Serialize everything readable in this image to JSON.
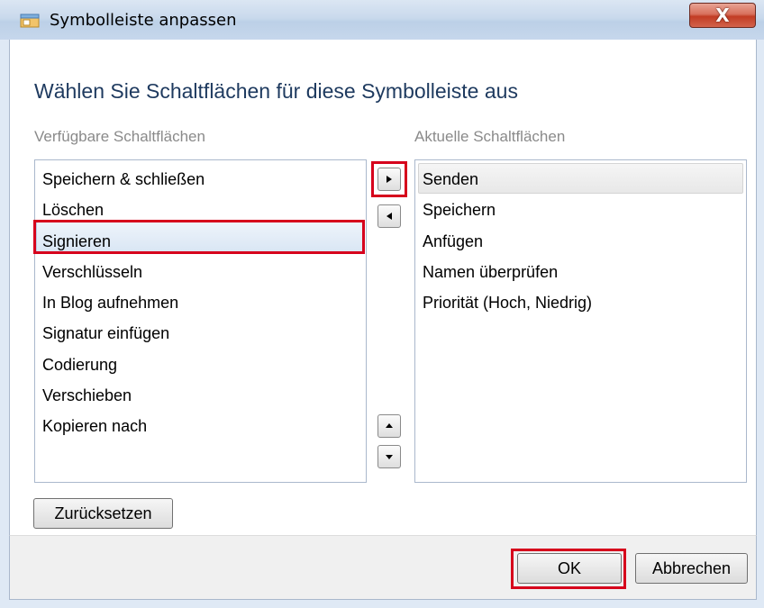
{
  "window": {
    "title": "Symbolleiste anpassen",
    "close_label": "X"
  },
  "dialog": {
    "heading": "Wählen Sie Schaltflächen für diese Symbolleiste aus",
    "available_label": "Verfügbare Schaltflächen",
    "current_label": "Aktuelle Schaltflächen"
  },
  "available": {
    "items": [
      "Speichern & schließen",
      "Löschen",
      "Signieren",
      "Verschlüsseln",
      "In Blog aufnehmen",
      "Signatur einfügen",
      "Codierung",
      "Verschieben",
      "Kopieren nach"
    ],
    "selected": "Signieren"
  },
  "current": {
    "items": [
      "Senden",
      "Speichern",
      "Anfügen",
      "Namen überprüfen",
      "Priorität (Hoch, Niedrig)"
    ],
    "selected": "Senden"
  },
  "buttons": {
    "reset": "Zurücksetzen",
    "ok": "OK",
    "cancel": "Abbrechen"
  },
  "colors": {
    "highlight": "#d6001c",
    "heading": "#1e3a5f",
    "close": "#c23c24"
  }
}
